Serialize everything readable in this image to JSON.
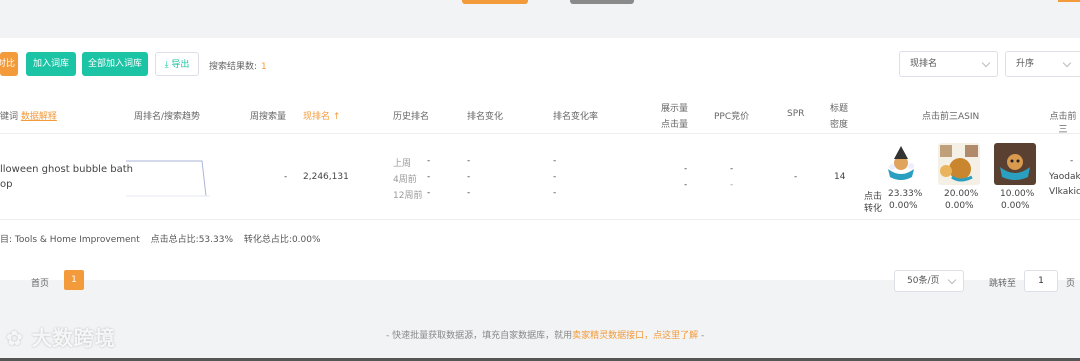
{
  "toolbar": {
    "btn_compare": "对比",
    "btn_add_lib": "加入词库",
    "btn_add_all": "全部加入词库",
    "btn_export": "导出",
    "result_label": "搜索结果数:",
    "result_count": "1",
    "sort_field": "现排名",
    "sort_order": "升序"
  },
  "table": {
    "headers": {
      "keyword": "键词",
      "data_explain": "数据解释",
      "week_rank_trend": "周排名/搜索趋势",
      "week_search": "周搜索量",
      "current_rank": "现排名 ↑",
      "history_rank": "历史排名",
      "rank_change": "排名变化",
      "rank_change_rate": "排名变化率",
      "impressions": "展示量",
      "clicks": "点击量",
      "ppc": "PPC竞价",
      "spr": "SPR",
      "title_density_1": "标题",
      "title_density_2": "密度",
      "top3_asin": "点击前三ASIN",
      "top3_more": "点击前三"
    },
    "row": {
      "keyword_line1": "lloween ghost bubble bath",
      "keyword_line2": "op",
      "week_search": "-",
      "current_rank": "2,246,131",
      "history_labels": [
        "上周",
        "4周前",
        "12周前"
      ],
      "history_values": [
        "-",
        "-",
        "-"
      ],
      "rank_change": [
        "-",
        "-",
        "-"
      ],
      "rank_change_rate": [
        "-",
        "-",
        "-"
      ],
      "impressions": "-",
      "clicks": "-",
      "ppc_1": "-",
      "ppc_2": "-",
      "spr": "-",
      "title_density": "14",
      "click_label": "点击",
      "conv_label": "转化",
      "asins": [
        {
          "click": "23.33%",
          "conv": "0.00%"
        },
        {
          "click": "20.00%",
          "conv": "0.00%"
        },
        {
          "click": "10.00%",
          "conv": "0.00%"
        }
      ],
      "brand_dash": "-",
      "brand_1": "Yaodak",
      "brand_2": "Vlkakic"
    }
  },
  "stats": {
    "category": "目: Tools & Home Improvement",
    "click_total": "点击总占比:53.33%",
    "conv_total": "转化总占比:0.00%"
  },
  "pager": {
    "first": "首页",
    "current": "1",
    "page_size": "50条/页",
    "jump_label": "跳转至",
    "jump_value": "1",
    "page_unit": "页"
  },
  "notice": {
    "prefix": "- 快速批量获取数据源，填充自家数据库，就用",
    "link": "卖家精灵数据接口，点这里了解",
    "suffix": " -"
  },
  "watermark": "大数跨境"
}
